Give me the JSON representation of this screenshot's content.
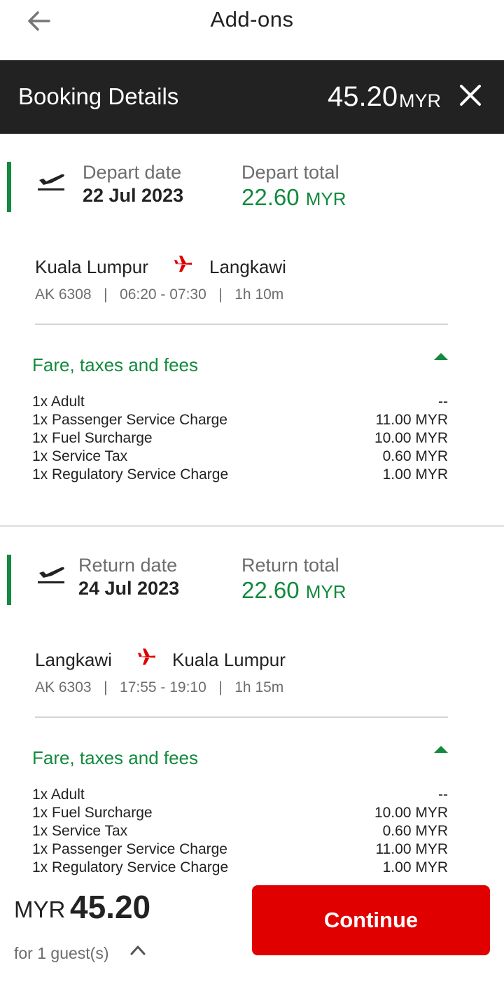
{
  "header": {
    "title": "Add-ons"
  },
  "booking": {
    "title": "Booking Details",
    "amount": "45.20",
    "currency": "MYR"
  },
  "depart": {
    "date_label": "Depart date",
    "date": "22 Jul 2023",
    "total_label": "Depart total",
    "total_amount": "22.60",
    "total_currency": "MYR",
    "from": "Kuala Lumpur",
    "to": "Langkawi",
    "meta": "AK 6308   |   06:20 - 07:30   |   1h 10m",
    "fare_title": "Fare, taxes and fees",
    "fares": [
      {
        "label": "1x Adult",
        "value": "--"
      },
      {
        "label": "1x Passenger Service Charge",
        "value": "11.00 MYR"
      },
      {
        "label": "1x Fuel Surcharge",
        "value": "10.00 MYR"
      },
      {
        "label": "1x Service Tax",
        "value": "0.60 MYR"
      },
      {
        "label": "1x Regulatory Service Charge",
        "value": "1.00 MYR"
      }
    ]
  },
  "return": {
    "date_label": "Return date",
    "date": "24 Jul 2023",
    "total_label": "Return total",
    "total_amount": "22.60",
    "total_currency": "MYR",
    "from": "Langkawi",
    "to": "Kuala Lumpur",
    "meta": "AK 6303   |   17:55 - 19:10   |   1h 15m",
    "fare_title": "Fare, taxes and fees",
    "fares": [
      {
        "label": "1x Adult",
        "value": "--"
      },
      {
        "label": "1x Fuel Surcharge",
        "value": "10.00 MYR"
      },
      {
        "label": "1x Service Tax",
        "value": "0.60 MYR"
      },
      {
        "label": "1x Passenger Service Charge",
        "value": "11.00 MYR"
      },
      {
        "label": "1x Regulatory Service Charge",
        "value": "1.00 MYR"
      }
    ]
  },
  "footer": {
    "currency": "MYR",
    "amount": "45.20",
    "guests": "for 1 guest(s)",
    "continue_label": "Continue"
  },
  "colors": {
    "accent_green": "#138a3d",
    "brand_red": "#e00000",
    "dark_bar": "#222222"
  },
  "icons": {
    "back": "arrow-left-icon",
    "close": "close-icon",
    "depart": "plane-takeoff-icon",
    "route": "airplane-icon",
    "chevron": "chevron-up-icon",
    "caret": "caret-up-icon"
  }
}
